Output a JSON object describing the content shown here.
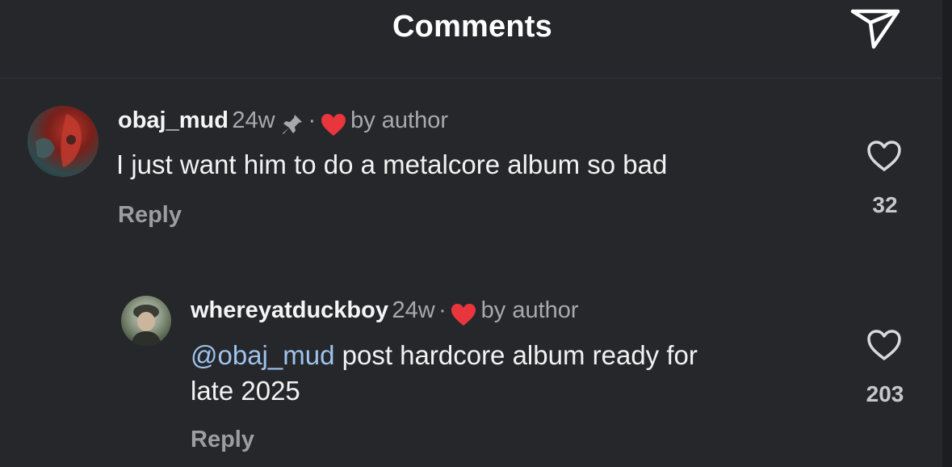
{
  "header": {
    "title": "Comments"
  },
  "comments": [
    {
      "username": "obaj_mud",
      "age": "24w",
      "separator": "·",
      "liked_by": "by author",
      "text": "I just want him to do a metalcore album so bad",
      "reply_label": "Reply",
      "like_count": "32"
    },
    {
      "username": "whereyatduckboy",
      "age": "24w",
      "separator": "·",
      "liked_by": "by author",
      "mention": "@obaj_mud",
      "text_line1": " post hardcore album ready for",
      "text_line2": "late 2025",
      "reply_label": "Reply",
      "like_count": "203"
    }
  ],
  "icons": {
    "send": "send-icon",
    "pin": "pin-icon",
    "author_heart": "heart-icon",
    "like": "like-heart-icon"
  },
  "colors": {
    "background": "#26272b",
    "heart_red": "#e9363d",
    "mention_blue": "#9ec3ec",
    "secondary_text": "#a8a9ad"
  }
}
